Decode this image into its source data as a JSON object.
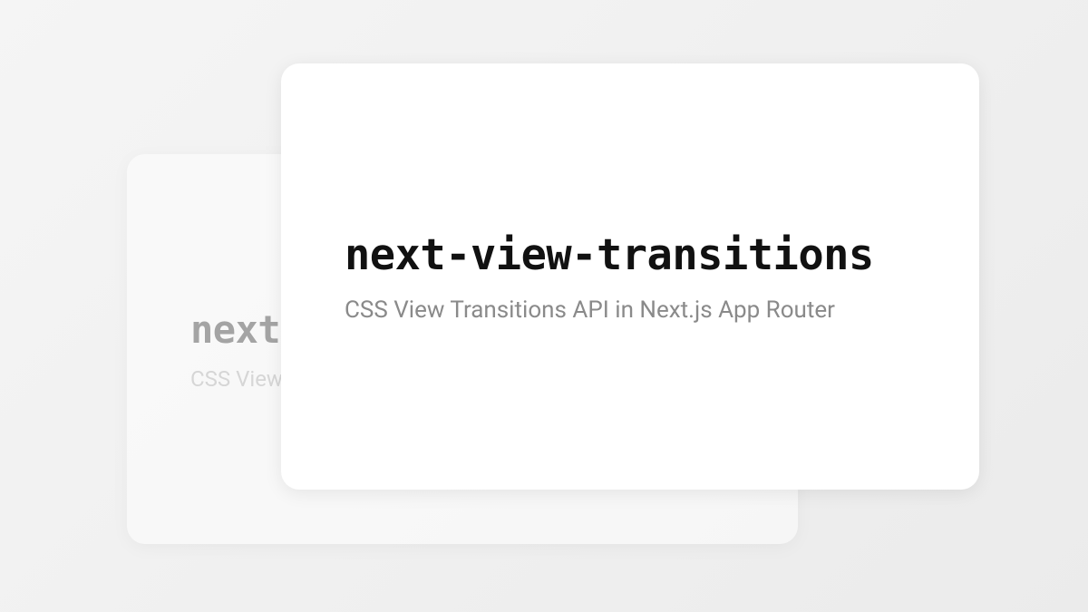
{
  "card_back": {
    "title": "next-view-transitions",
    "subtitle": "CSS View Transitions API in Next.js App Router"
  },
  "card_front": {
    "title": "next-view-transitions",
    "subtitle": "CSS View Transitions API in Next.js App Router"
  }
}
